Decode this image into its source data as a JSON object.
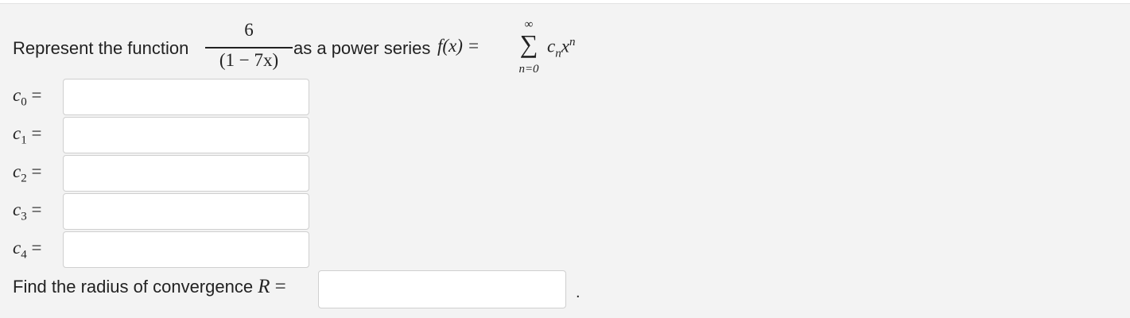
{
  "question": {
    "prefix": "Represent the function",
    "fraction_numerator": "6",
    "fraction_denominator": "(1 − 7x)",
    "middle": "as a power series",
    "series_lhs": "f(x) =",
    "sum_upper": "∞",
    "sum_symbol": "∑",
    "sum_lower": "n=0",
    "term_coef": "c",
    "term_coef_sub": "n",
    "term_var": "x",
    "term_exp": "n"
  },
  "coefficients": [
    {
      "symbol": "c",
      "index": "0",
      "equals": "=",
      "value": ""
    },
    {
      "symbol": "c",
      "index": "1",
      "equals": "=",
      "value": ""
    },
    {
      "symbol": "c",
      "index": "2",
      "equals": "=",
      "value": ""
    },
    {
      "symbol": "c",
      "index": "3",
      "equals": "=",
      "value": ""
    },
    {
      "symbol": "c",
      "index": "4",
      "equals": "=",
      "value": ""
    }
  ],
  "radius": {
    "prompt": "Find the radius of convergence",
    "variable": "R",
    "equals": "=",
    "value": "",
    "trailing": "."
  }
}
